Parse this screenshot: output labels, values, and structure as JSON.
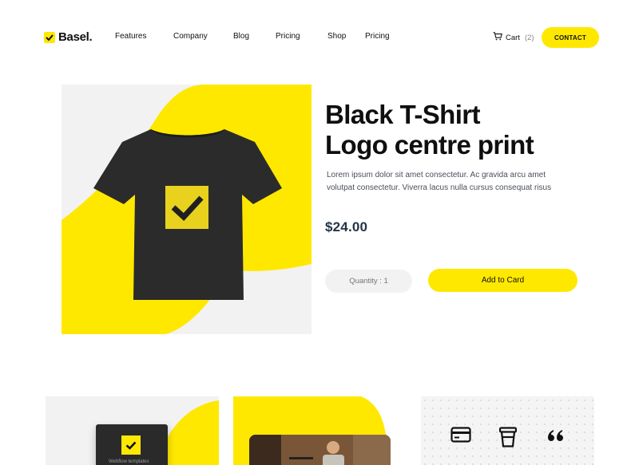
{
  "header": {
    "logo": "Basel.",
    "nav": [
      {
        "label": "Features"
      },
      {
        "label": "Company"
      },
      {
        "label": "Blog"
      },
      {
        "label": "Pricing"
      },
      {
        "label": "Shop"
      },
      {
        "label": "Pricing"
      }
    ],
    "cart_label": "Cart",
    "cart_count": "(2)",
    "contact_label": "CONTACT"
  },
  "product": {
    "title_line1": "Black T-Shirt",
    "title_line2": "Logo centre print",
    "description": "Lorem ipsum dolor sit amet consectetur. Ac gravida arcu amet volutpat consectetur. Viverra lacus nulla cursus consequat risus",
    "price": "$24.00",
    "quantity_placeholder": "Quantity : 1",
    "add_button": "Add to Card"
  },
  "bottom_cards": {
    "book_text": "Webflow templates",
    "icons": [
      "credit-card-icon",
      "cup-icon",
      "quote-icon"
    ]
  },
  "colors": {
    "accent": "#ffe800",
    "card_bg": "#f2f2f3",
    "price": "#243447"
  }
}
